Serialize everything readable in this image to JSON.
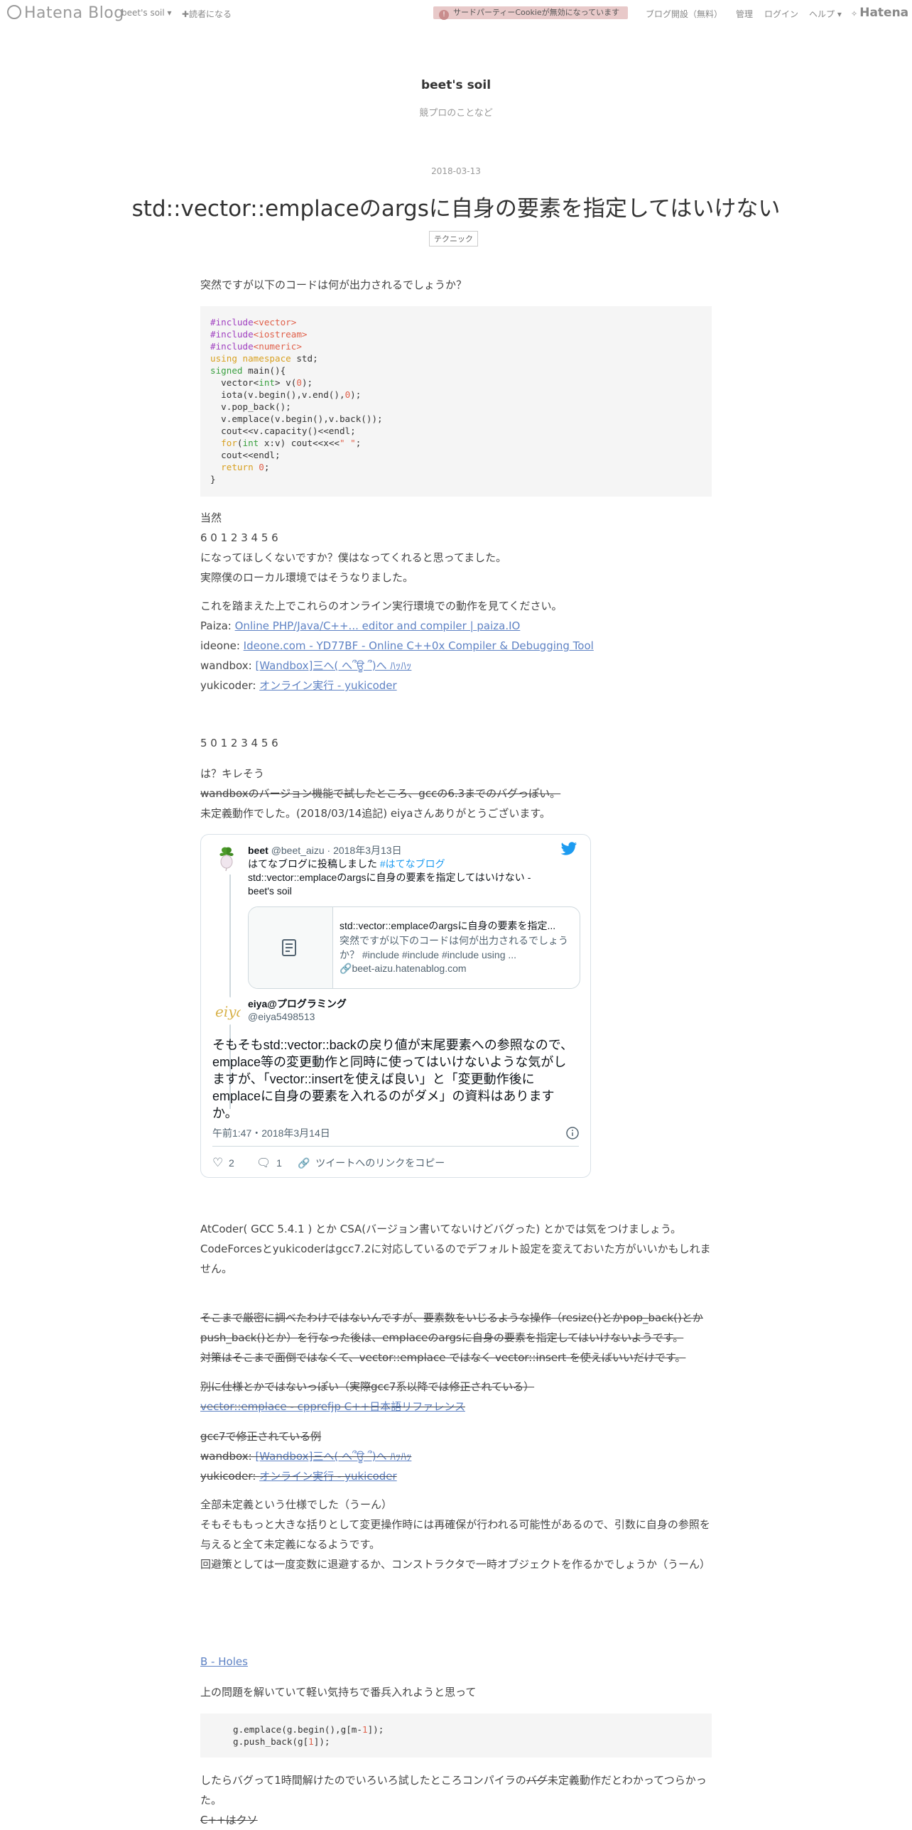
{
  "topbar": {
    "logo": "Hatena Blog",
    "blog_menu": "beet's soil ▾",
    "subscribe": "✚読者になる",
    "cookie_notice": "サードパーティーCookieが無効になっています",
    "cookie_icon": "!",
    "open_blog": "ブログ開設（無料）",
    "manage": "管理",
    "login": "ログイン",
    "help": "ヘルプ ▾",
    "hatena": "Hatena"
  },
  "blog": {
    "title": "beet's soil",
    "description": "競プロのことなど"
  },
  "entry": {
    "date": "2018-03-13",
    "title": "std::vector::emplaceのargsに自身の要素を指定してはいけない",
    "tag": "テクニック",
    "intro": "突然ですが以下のコードは何が出力されるでしょうか？",
    "code1": [
      "#include<vector>",
      "#include<iostream>",
      "#include<numeric>",
      "using namespace std;",
      "signed main(){",
      "  vector<int> v(0);",
      "  iota(v.begin(),v.end(),0);",
      "  v.pop_back();",
      "  v.emplace(v.begin(),v.back());",
      "  cout<<v.capacity()<<endl;",
      "  for(int x:v) cout<<x<<\" \";",
      "  cout<<endl;",
      "  return 0;",
      "}"
    ],
    "p1": [
      "当然",
      "6 0 1 2 3 4 5 6",
      "になってほしくないですか？僕はなってくれると思ってました。",
      "実際僕のローカル環境ではそうなりました。"
    ],
    "p2": "これを踏まえた上でこれらのオンライン実行環境での動作を見てください。",
    "envs": [
      {
        "label": "Paiza: ",
        "link": "Online PHP/Java/C++... editor and compiler | paiza.IO"
      },
      {
        "label": "ideone: ",
        "link": "Ideone.com - YD77BF - Online C++0x Compiler & Debugging Tool"
      },
      {
        "label": "wandbox: ",
        "link": "[Wandbox]三へ( へ՞ਊ ՞)へ ﾊｯﾊｯ"
      },
      {
        "label": "yukicoder: ",
        "link": "オンライン実行 - yukicoder"
      }
    ],
    "result": "5 0 1 2 3 4 5 6",
    "p3_a": "は？キレそう",
    "p3_strike": "wandboxのバージョン機能で試したところ、gccの6.3までのバグっぽい。",
    "p3_c": "未定義動作でした。(2018/03/14追記) eiyaさんありがとうございます。",
    "tweet": {
      "name1": "beet",
      "handle1": "@beet_aizu",
      "date1": "2018年3月13日",
      "text1_a": "はてなブログに投稿しました ",
      "text1_tag": "#はてなブログ",
      "text1_b": "std::vector::emplaceのargsに自身の要素を指定してはいけない - beet's soil",
      "card_title": "std::vector::emplaceのargsに自身の要素を指定...",
      "card_desc": "突然ですが以下のコードは何が出力されるでしょうか？ #include #include #include using ...",
      "card_url": "beet-aizu.hatenablog.com",
      "name2": "eiya@プログラミング",
      "handle2": "@eiya5498513",
      "main_text": "そもそもstd::vector::backの戻り値が末尾要素への参照なので、emplace等の変更動作と同時に使ってはいけないような気がしますが、「vector::insertを使えば良い」と「変更動作後にemplaceに自身の要素を入れるのがダメ」の資料はありますか。",
      "time": "午前1:47・2018年3月14日",
      "likes": "2",
      "replies": "1",
      "copy": "ツイートへのリンクをコピー"
    },
    "p4": [
      "AtCoder( GCC 5.4.1 ) とか CSA(バージョン書いてないけどバグった) とかでは気をつけましょう。",
      "CodeForcesとyukicoderはgcc7.2に対応しているのでデフォルト設定を変えておいた方がいいかもしれません。"
    ],
    "p5_strike": [
      "そこまで厳密に調べたわけではないんですが、要素数をいじるような操作（resize()とかpop_back()とかpush_back()とか）を行なった後は、emplaceのargsに自身の要素を指定してはいけないようです。",
      "対策はそこまで面倒ではなくて、vector::emplace ではなく vector::insert を使えばいいだけです。"
    ],
    "p6_strike": "別に仕様とかではないっぽい（実際gcc7系以降では修正されている）",
    "p6_link": "vector::emplace - cpprefjp C++日本語リファレンス",
    "p7_head": "gcc7で修正されている例",
    "p7_rows": [
      {
        "label": "wandbox: ",
        "link": "[Wandbox]三へ( へ՞ਊ ՞)へ ﾊｯﾊｯ"
      },
      {
        "label": "yukicoder: ",
        "link": "オンライン実行 - yukicoder"
      }
    ],
    "p8": [
      "全部未定義という仕様でした（うーん）",
      "そもそももっと大きな括りとして変更操作時には再確保が行われる可能性があるので、引数に自身の参照を与えると全て未定義になるようです。",
      "回避策としては一度変数に退避するか、コンストラクタで一時オブジェクトを作るかでしょうか（うーん）"
    ],
    "section_link": "B - Holes",
    "p9": "上の問題を解いていて軽い気持ちで番兵入れようと思って",
    "code2": [
      "g.emplace(g.begin(),g[m-1]);",
      "g.push_back(g[1]);"
    ],
    "p10_a": "したらバグって1時間解けたのでいろいろ試したところコンパイラの",
    "p10_strike": "バグ",
    "p10_b": "未定義動作だとわかってつらかった。",
    "p11_strike": "C++はクソ"
  }
}
